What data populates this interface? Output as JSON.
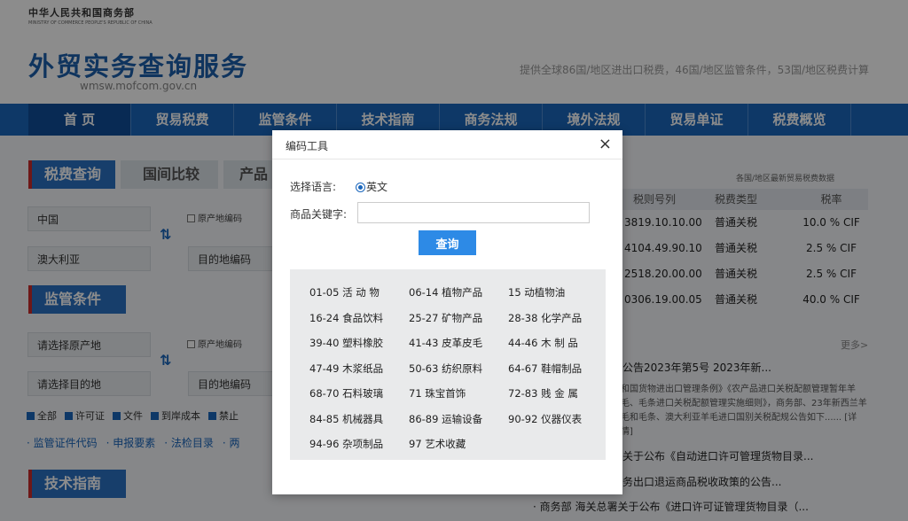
{
  "header": {
    "ministry_cn": "中华人民共和国商务部",
    "ministry_en": "MINISTRY OF COMMERCE PEOPLE'S REPUBLIC OF CHINA",
    "title": "外贸实务查询服务",
    "url": "wmsw.mofcom.gov.cn",
    "tagline": "提供全球86国/地区进出口税费，46国/地区监管条件，53国/地区税费计算"
  },
  "nav": [
    "首 页",
    "贸易税费",
    "监管条件",
    "技术指南",
    "商务法规",
    "境外法规",
    "贸易单证",
    "税费概览"
  ],
  "left": {
    "tabs": {
      "tax": "税费查询",
      "compare": "国间比较",
      "product": "产品"
    },
    "origin_value": "中国",
    "origin_code_label": "原产地编码",
    "dest_value": "澳大利亚",
    "dest_code": "目的地编码",
    "reg_title": "监管条件",
    "reg_origin_placeholder": "请选择原产地",
    "reg_origin_code_label": "原产地编码",
    "reg_dest_placeholder": "请选择目的地",
    "reg_dest_code": "目的地编码",
    "checks": [
      "全部",
      "许可证",
      "文件",
      "到岸成本",
      "禁止"
    ],
    "links": [
      "· 监管证件代码",
      "· 申报要素",
      "· 法检目录",
      "· 两"
    ],
    "tech_title": "技术指南"
  },
  "right": {
    "note": "各国/地区最新贸易税费数据",
    "headers": [
      "税则号列",
      "税费类型",
      "税率"
    ],
    "rows": [
      [
        "3819.10.10.00",
        "普通关税",
        "10.0 % CIF"
      ],
      [
        "4104.49.90.10",
        "普通关税",
        "2.5 % CIF"
      ],
      [
        "2518.20.00.00",
        "普通关税",
        "2.5 % CIF"
      ],
      [
        "0306.19.00.05",
        "普通关税",
        "40.0 % CIF"
      ]
    ],
    "more": "更多>",
    "news": [
      "公告2023年第5号 2023年新...",
      "关于公布《自动进口许可管理货物目录...",
      "务出口退运商品税收政策的公告...",
      "· 商务部 海关总署关于公布《进口许可证管理货物目录（..."
    ],
    "news_body": "和国货物进出口管理条例》《农产品进口关税配额管理暂年羊毛、毛条进口关税配额管理实施细则》，商务部、23年新西兰羊毛和毛条、澳大利亚羊毛进口国别关税配规公告如下...... [详情]"
  },
  "modal": {
    "title": "编码工具",
    "close": "×",
    "lang_label": "选择语言:",
    "lang_option": "英文",
    "keyword_label": "商品关键字:",
    "keyword_value": "",
    "query_button": "查询",
    "codes": [
      "01-05 活  动  物",
      "06-14 植物产品",
      "15      动植物油",
      "16-24 食品饮料",
      "25-27 矿物产品",
      "28-38 化学产品",
      "39-40 塑料橡胶",
      "41-43 皮革皮毛",
      "44-46 木  制  品",
      "47-49 木浆纸品",
      "50-63 纺织原料",
      "64-67 鞋帽制品",
      "68-70 石料玻璃",
      "71      珠宝首饰",
      "72-83 贱  金  属",
      "84-85 机械器具",
      "86-89 运输设备",
      "90-92 仪器仪表",
      "94-96 杂项制品",
      "97      艺术收藏"
    ]
  }
}
